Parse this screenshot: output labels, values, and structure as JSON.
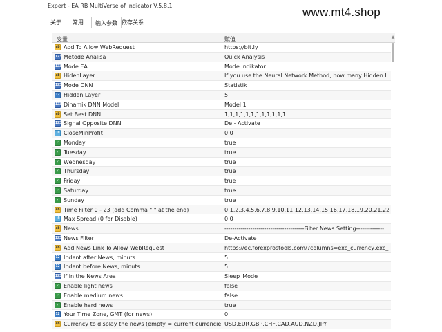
{
  "window": {
    "title": "Expert - EA RB MultiVerse of Indicator V.5.8.1",
    "watermark": "www.mt4.shop"
  },
  "tabs": [
    {
      "label": "关于",
      "active": false
    },
    {
      "label": "常用",
      "active": false
    },
    {
      "label": "输入参数",
      "active": true
    },
    {
      "label": "依存关系",
      "active": false
    }
  ],
  "grid": {
    "col_variable": "变量",
    "col_value": "赋值"
  },
  "params": [
    {
      "icon": "ab",
      "name": "Add To Allow WebRequest",
      "value": "https://bit.ly"
    },
    {
      "icon": "num",
      "name": "Metode Analisa",
      "value": "Quick Analysis"
    },
    {
      "icon": "num",
      "name": "Mode EA",
      "value": "Mode Indikator"
    },
    {
      "icon": "ab",
      "name": "HidenLayer",
      "value": "If you use the Neural Network Method, how many Hidden L..."
    },
    {
      "icon": "num",
      "name": "Mode DNN",
      "value": "Statistik"
    },
    {
      "icon": "val",
      "name": "Hidden Layer",
      "value": "5"
    },
    {
      "icon": "num",
      "name": "Dinamik DNN Model",
      "value": "Model 1"
    },
    {
      "icon": "ab",
      "name": "Set Best DNN",
      "value": "1,1,1,1,1,1,1,1,1,1,1,1"
    },
    {
      "icon": "num",
      "name": "Signal Opposite DNN",
      "value": "De - Activate"
    },
    {
      "icon": "dbl",
      "name": "CloseMinProfit",
      "value": "0.0"
    },
    {
      "icon": "bool",
      "name": "Monday",
      "value": "true"
    },
    {
      "icon": "bool",
      "name": "Tuesday",
      "value": "true"
    },
    {
      "icon": "bool",
      "name": "Wednesday",
      "value": "true"
    },
    {
      "icon": "bool",
      "name": "Thursday",
      "value": "true"
    },
    {
      "icon": "bool",
      "name": "Friday",
      "value": "true"
    },
    {
      "icon": "bool",
      "name": "Saturday",
      "value": "true"
    },
    {
      "icon": "bool",
      "name": "Sunday",
      "value": "true"
    },
    {
      "icon": "ab",
      "name": "Time Filter 0 - 23 (add Comma \",\" at the end)",
      "value": "0,1,2,3,4,5,6,7,8,9,10,11,12,13,14,15,16,17,18,19,20,21,22,23,"
    },
    {
      "icon": "dbl",
      "name": "Max Spread (0 for Disable)",
      "value": "0.0"
    },
    {
      "icon": "ab",
      "name": "News",
      "value": "----------------------------------------Filter News Setting--------------"
    },
    {
      "icon": "num",
      "name": "News Filter",
      "value": "De-Activate"
    },
    {
      "icon": "ab",
      "name": "Add News Link To Allow WebRequest",
      "value": "https://ec.forexprostools.com/?columns=exc_currency,exc_im..."
    },
    {
      "icon": "val",
      "name": "Indent after News, minuts",
      "value": "5"
    },
    {
      "icon": "val",
      "name": "Indent before News, minuts",
      "value": "5"
    },
    {
      "icon": "num",
      "name": "If in the News Area",
      "value": "Sleep_Mode"
    },
    {
      "icon": "bool",
      "name": "Enable light news",
      "value": "false"
    },
    {
      "icon": "bool",
      "name": "Enable medium news",
      "value": "false"
    },
    {
      "icon": "bool",
      "name": "Enable hard news",
      "value": "true"
    },
    {
      "icon": "val",
      "name": "Your Time Zone, GMT (for news)",
      "value": "0"
    },
    {
      "icon": "ab",
      "name": "Currency to display the news (empty = current currencies)",
      "value": "USD,EUR,GBP,CHF,CAD,AUD,NZD,JPY"
    }
  ]
}
